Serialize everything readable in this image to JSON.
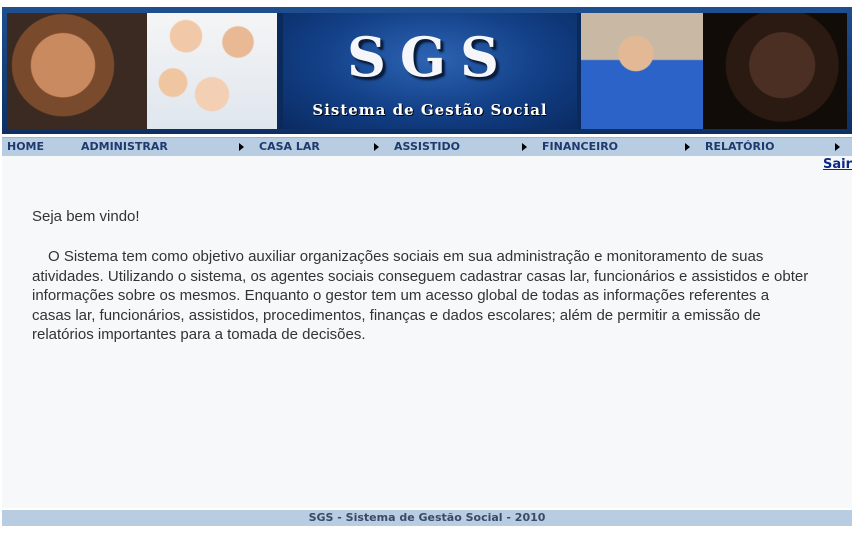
{
  "banner": {
    "logo_text": "SGS",
    "subtitle": "Sistema de Gestão Social"
  },
  "menu": {
    "items": [
      {
        "label": "HOME"
      },
      {
        "label": "ADMINISTRAR"
      },
      {
        "label": "CASA LAR"
      },
      {
        "label": "ASSISTIDO"
      },
      {
        "label": "FINANCEIRO"
      },
      {
        "label": "RELATÓRIO"
      }
    ]
  },
  "content": {
    "logout_label": "Sair",
    "welcome": "Seja bem vindo!",
    "description": "O Sistema tem como objetivo auxiliar organizações sociais em sua administração e monitoramento de suas atividades. Utilizando o sistema, os agentes sociais conseguem cadastrar casas lar, funcionários e assistidos e obter informações sobre os mesmos. Enquanto o gestor tem um acesso global de todas as informações referentes a casas lar, funcionários, assistidos, procedimentos, finanças e dados escolares; além de permitir a emissão de relatórios importantes para a tomada de decisões."
  },
  "footer": {
    "text": "SGS - Sistema de Gestão Social - 2010"
  }
}
